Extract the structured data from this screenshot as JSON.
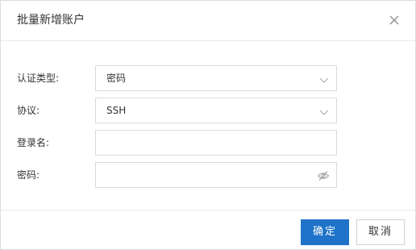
{
  "dialog": {
    "title": "批量新增账户",
    "close_icon": "close-icon"
  },
  "form": {
    "auth_type": {
      "label": "认证类型:",
      "value": "密码",
      "icon": "chevron-down-icon"
    },
    "protocol": {
      "label": "协议:",
      "value": "SSH",
      "icon": "chevron-down-icon"
    },
    "login_name": {
      "label": "登录名:",
      "value": ""
    },
    "password": {
      "label": "密码:",
      "value": "",
      "icon": "eye-hidden-icon"
    }
  },
  "footer": {
    "confirm_label": "确定",
    "cancel_label": "取消"
  },
  "colors": {
    "primary": "#1f73c9",
    "border": "#d9d9d9",
    "divider": "#e8e8e8"
  }
}
